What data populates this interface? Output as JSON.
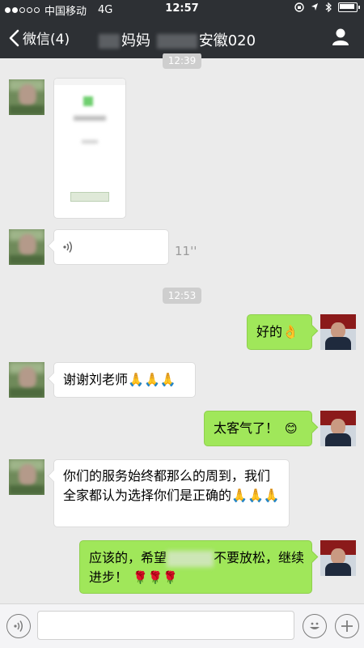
{
  "status_bar": {
    "carrier": "中国移动",
    "network": "4G",
    "time": "12:57"
  },
  "nav": {
    "back_label": "微信(4)",
    "title_part1": "妈妈",
    "title_part2": "安徽020"
  },
  "timestamps": [
    "12:39",
    "12:53"
  ],
  "messages": [
    {
      "side": "left",
      "type": "image"
    },
    {
      "side": "left",
      "type": "voice",
      "duration": "11''"
    },
    {
      "side": "right",
      "type": "text",
      "text": "好的"
    },
    {
      "side": "left",
      "type": "text",
      "text": "谢谢刘老师"
    },
    {
      "side": "right",
      "type": "text",
      "text": "太客气了！"
    },
    {
      "side": "left",
      "type": "text",
      "text": "你们的服务始终都那么的周到，我们全家都认为选择你们是正确的"
    },
    {
      "side": "right",
      "type": "text",
      "text_part1": "应该的，希望",
      "text_part2": "不要放松，继续进步！"
    }
  ],
  "icons": {
    "back": "chevron-left-icon",
    "profile": "person-icon",
    "voice": "voice-wave-icon",
    "emoji": "smiley-icon",
    "add": "plus-icon",
    "ok_hand": "ok-hand-emoji",
    "pray": "pray-emoji",
    "rose": "rose-emoji"
  },
  "colors": {
    "header_bg": "#2d3034",
    "chat_bg": "#ebebeb",
    "bubble_self": "#a0e75a",
    "bubble_other": "#ffffff"
  }
}
